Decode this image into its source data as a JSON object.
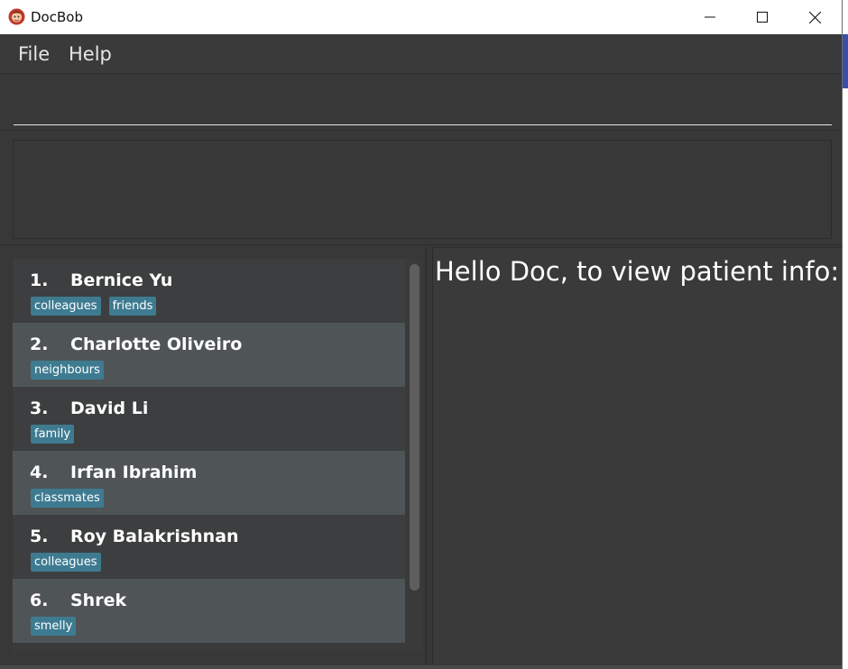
{
  "window": {
    "title": "DocBob",
    "icon": "docbob-app-icon",
    "controls": [
      "minimize-icon",
      "maximize-icon",
      "close-icon"
    ]
  },
  "menu": {
    "file_label": "File",
    "help_label": "Help"
  },
  "command_box": {
    "value": "",
    "placeholder": ""
  },
  "result_display": {
    "text": ""
  },
  "patients": [
    {
      "index": "1.",
      "name": "Bernice Yu",
      "tags": [
        "colleagues",
        "friends"
      ]
    },
    {
      "index": "2.",
      "name": "Charlotte Oliveiro",
      "tags": [
        "neighbours"
      ]
    },
    {
      "index": "3.",
      "name": "David Li",
      "tags": [
        "family"
      ]
    },
    {
      "index": "4.",
      "name": "Irfan Ibrahim",
      "tags": [
        "classmates"
      ]
    },
    {
      "index": "5.",
      "name": "Roy Balakrishnan",
      "tags": [
        "colleagues"
      ]
    },
    {
      "index": "6.",
      "name": "Shrek",
      "tags": [
        "smelly"
      ]
    }
  ],
  "info_panel": {
    "greeting": "Hello Doc, to view patient info:"
  },
  "colors": {
    "background": "#383838",
    "card_alt": "#4f5556",
    "tag": "#3e7b91",
    "text": "#ffffff"
  }
}
